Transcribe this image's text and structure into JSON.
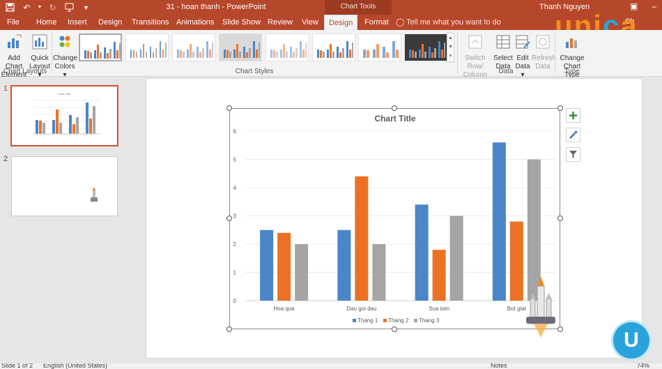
{
  "titlebar": {
    "doc_title": "31 - hoan thanh  -  PowerPoint",
    "context_label": "Chart Tools",
    "user": "Thanh Nguyen",
    "icons": [
      "save-icon",
      "undo-icon",
      "redo-icon",
      "present-icon",
      "qat-more-icon"
    ]
  },
  "tabs": [
    {
      "label": "File"
    },
    {
      "label": "Home"
    },
    {
      "label": "Insert"
    },
    {
      "label": "Design"
    },
    {
      "label": "Transitions"
    },
    {
      "label": "Animations"
    },
    {
      "label": "Slide Show"
    },
    {
      "label": "Review"
    },
    {
      "label": "View"
    },
    {
      "label": "Design"
    },
    {
      "label": "Format"
    }
  ],
  "tell_me": "Tell me what you want to do",
  "share_partial": "Sh",
  "watermark": {
    "text_part1": "uni",
    "text_part2": "c",
    "text_part3": "a",
    "badge": "U"
  },
  "ribbon": {
    "add_chart_element": {
      "line1": "Add Chart",
      "line2": "Element ▾"
    },
    "quick_layout": {
      "line1": "Quick",
      "line2": "Layout ▾"
    },
    "group_chart_layouts": "Chart Layouts",
    "change_colors": {
      "line1": "Change",
      "line2": "Colors ▾"
    },
    "group_chart_styles": "Chart Styles",
    "switch_row_column": {
      "line1": "Switch Row/",
      "line2": "Column"
    },
    "select_data": {
      "line1": "Select",
      "line2": "Data"
    },
    "edit_data": {
      "line1": "Edit",
      "line2": "Data ▾"
    },
    "refresh_data": {
      "line1": "Refresh",
      "line2": "Data"
    },
    "group_data": "Data",
    "change_chart_type": {
      "line1": "Change",
      "line2": "Chart Type"
    },
    "group_type": "Type"
  },
  "slides": [
    {
      "number": "1"
    },
    {
      "number": "2"
    }
  ],
  "colors": {
    "accent": "#b7472a",
    "series1": "#4a86c8",
    "series2": "#ed7125",
    "series3": "#a5a5a5"
  },
  "status": {
    "slide_of": "Slide 1 of 2",
    "language": "English (United States)",
    "notes": "Notes",
    "zoom": "74%"
  },
  "chart_data": {
    "type": "bar",
    "title": "Chart Title",
    "categories": [
      "Hoa qua",
      "Dau goi dau",
      "Sua tam",
      "Bot giat"
    ],
    "series": [
      {
        "name": "Thang 1",
        "values": [
          2.5,
          2.5,
          3.4,
          5.6
        ]
      },
      {
        "name": "Thang 2",
        "values": [
          2.4,
          4.4,
          1.8,
          2.8
        ]
      },
      {
        "name": "Thang 3",
        "values": [
          2,
          2,
          3,
          5
        ]
      }
    ],
    "ylim": [
      0,
      6
    ],
    "yticks": [
      "0",
      "1",
      "2",
      "3",
      "4",
      "5",
      "6"
    ],
    "grid": true,
    "legend_position": "bottom"
  }
}
